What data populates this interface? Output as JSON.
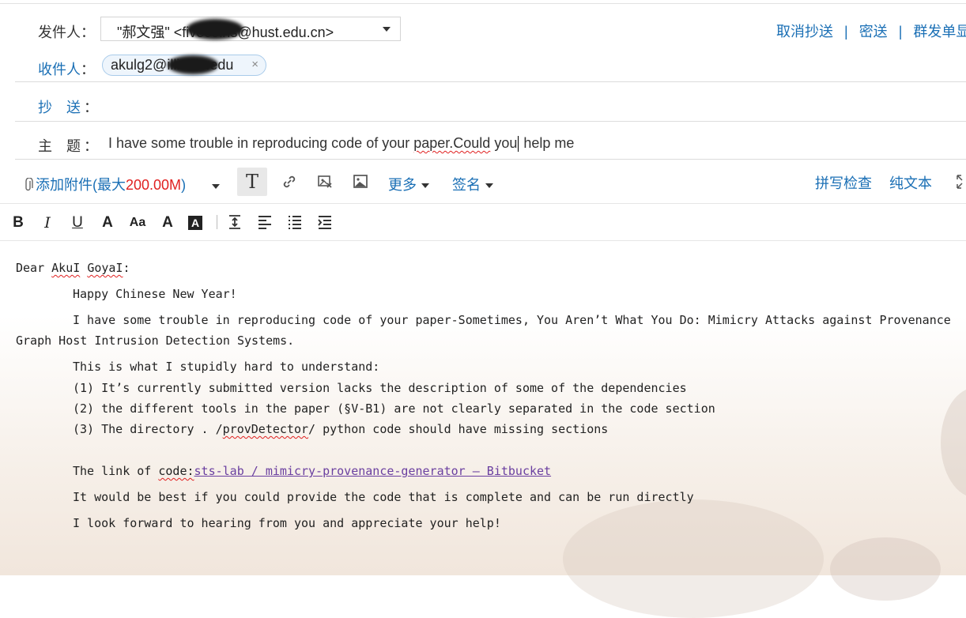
{
  "header": {
    "from_label": "发件人",
    "from_value": "\"郝文强\" <fivecoins@hust.edu.cn>",
    "to_label": "收件人",
    "to_chip": "akulg2@illinois.edu",
    "to_chip_close": "×",
    "cc_label": "抄　送",
    "subject_label": "主　题",
    "subject_part1": "I have some trouble in reproducing code of your ",
    "subject_part2": "paper.Could",
    "subject_part3": " you",
    "subject_part4": " help me",
    "colon": "："
  },
  "top_links": {
    "cancel_cc": "取消抄送",
    "bcc": "密送",
    "group_send": "群发单显",
    "separator": "|"
  },
  "toolbar": {
    "attach_label": "添加附件(最大",
    "attach_size": "200.00M",
    "attach_close_paren": ")",
    "more_label": "更多",
    "signature_label": "签名",
    "spellcheck_label": "拼写检查",
    "plaintext_label": "纯文本"
  },
  "format_toolbar": [
    "B",
    "I",
    "U",
    "A",
    "Aa",
    "A",
    "A"
  ],
  "body": {
    "greeting_pre": "Dear ",
    "greeting_name1": "AkuI",
    "greeting_space": " ",
    "greeting_name2": "GoyaI",
    "greeting_post": ":",
    "line1": "Happy Chinese New Year!",
    "line2a": "I have some trouble in reproducing code of your paper-Sometimes, You Aren’t What You Do: Mimicry Attacks against Provenance",
    "line2b": "Graph Host Intrusion Detection Systems.",
    "line3": "This is what I stupidly hard to understand:",
    "item1": "(1) It’s currently submitted version lacks the description of some of the dependencies",
    "item2": "(2) the different tools in the paper (§V-B1) are not clearly separated in the code section",
    "item3_pre": "(3) The directory . /",
    "item3_word": "provDetector",
    "item3_post": "/ python code should have missing sections",
    "link_pre": "The link of ",
    "link_word": "code:",
    "link_text": "sts-lab / mimicry-provenance-generator — Bitbucket",
    "line5": "It would be best if you could provide the code that is complete and can be run directly",
    "line6": "I look forward to hearing from you and appreciate your help!"
  },
  "colors": {
    "link_blue": "#1a6fb5",
    "attach_red": "#e02020",
    "body_link_purple": "#6a3fa0"
  }
}
